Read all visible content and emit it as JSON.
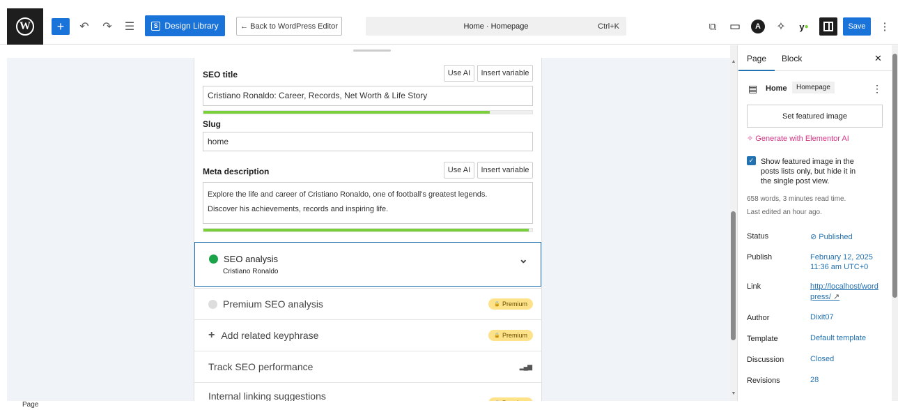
{
  "toolbar": {
    "wp_logo": "W",
    "add": "+",
    "undo": "↶",
    "redo": "↷",
    "list_view": "☰",
    "design_library_icon": "S",
    "design_library": "Design Library",
    "back": "← Back to WordPress Editor",
    "command_title": "Home · Homepage",
    "command_shortcut": "Ctrl+K",
    "view_icon": "⧉",
    "device_icon": "▭",
    "elementor_icon": "A",
    "ai_icon": "✧",
    "yoast_icon": "y",
    "save": "Save",
    "more": "⋮"
  },
  "seo": {
    "title_label": "SEO title",
    "use_ai": "Use AI",
    "insert_variable": "Insert variable",
    "title_value": "Cristiano Ronaldo: Career, Records, Net Worth & Life Story",
    "title_progress": 0.87,
    "slug_label": "Slug",
    "slug_value": "home",
    "meta_label": "Meta description",
    "meta_line1": "Explore the life and career of Cristiano Ronaldo, one of football's greatest legends.",
    "meta_line2": "Discover his achievements, records and inspiring life.",
    "meta_progress": 0.99,
    "analysis_title": "SEO analysis",
    "analysis_keyphrase": "Cristiano Ronaldo",
    "analysis_chevron": "⌄",
    "premium_analysis": "Premium SEO analysis",
    "premium_badge": "Premium",
    "lock": "🔒",
    "add_keyphrase": "Add related keyphrase",
    "add_icon": "+",
    "track": "Track SEO performance",
    "track_icon": "▂▄▆",
    "internal_linking": "Internal linking suggestions"
  },
  "sidebar": {
    "tab_page": "Page",
    "tab_block": "Block",
    "close": "✕",
    "page_icon": "▤",
    "page_title": "Home",
    "page_template": "Homepage",
    "more": "⋮",
    "set_featured": "Set featured image",
    "generate_icon": "✧",
    "generate_ai": "Generate with Elementor AI",
    "check": "✓",
    "show_featured_1": "Show featured image in the",
    "show_featured_2": "posts lists only, but hide it in",
    "show_featured_3": "the single post view.",
    "read_time": "658 words, 3 minutes read time.",
    "last_edited": "Last edited an hour ago.",
    "status_label": "Status",
    "status_icon": "⊘",
    "status_value": "Published",
    "publish_label": "Publish",
    "publish_value_1": "February 12, 2025",
    "publish_value_2": "11:36 am UTC+0",
    "link_label": "Link",
    "link_value_1": "http://localhost/word",
    "link_value_2": "press/",
    "link_arrow": "↗",
    "author_label": "Author",
    "author_value": "Dixit07",
    "template_label": "Template",
    "template_value": "Default template",
    "discussion_label": "Discussion",
    "discussion_value": "Closed",
    "revisions_label": "Revisions",
    "revisions_value": "28"
  },
  "footer": {
    "status": "Page"
  },
  "colors": {
    "accent": "#1a73d9",
    "progress_good": "#7ad03a",
    "premium": "#fde289",
    "ai_link": "#d63384"
  }
}
